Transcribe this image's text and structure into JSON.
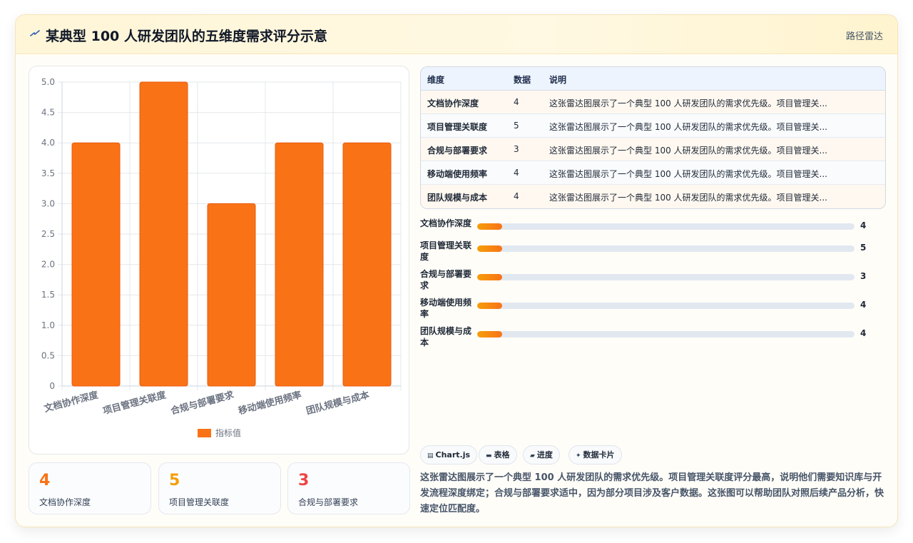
{
  "header": {
    "title": "某典型 100 人研发团队的五维度需求评分示意",
    "route_link": "路径雷达",
    "logo_icon": "lightning-icon"
  },
  "chart_data": {
    "type": "bar",
    "categories": [
      "文档协作深度",
      "项目管理关联度",
      "合规与部署要求",
      "移动端使用频率",
      "团队规模与成本"
    ],
    "series": [
      {
        "name": "指标值",
        "values": [
          4,
          5,
          3,
          4,
          4
        ],
        "color": "#f97316"
      }
    ],
    "ylim": [
      0,
      5
    ],
    "yticks": [
      "0",
      "0.5",
      "1.0",
      "1.5",
      "2.0",
      "2.5",
      "3.0",
      "3.5",
      "4.0",
      "4.5",
      "5.0"
    ],
    "grid": true,
    "legend": "bottom"
  },
  "stats": [
    {
      "value": "4",
      "label": "文档协作深度",
      "color": "#f97316"
    },
    {
      "value": "5",
      "label": "项目管理关联度",
      "color": "#f59e0b"
    },
    {
      "value": "3",
      "label": "合规与部署要求",
      "color": "#ef4444"
    }
  ],
  "table": {
    "headers": [
      "维度",
      "数据",
      "说明"
    ],
    "rows": [
      [
        "文档协作深度",
        "4",
        "这张雷达图展示了一个典型 100 人研发团队的需求优先级。项目管理关..."
      ],
      [
        "项目管理关联度",
        "5",
        "这张雷达图展示了一个典型 100 人研发团队的需求优先级。项目管理关..."
      ],
      [
        "合规与部署要求",
        "3",
        "这张雷达图展示了一个典型 100 人研发团队的需求优先级。项目管理关..."
      ],
      [
        "移动端使用频率",
        "4",
        "这张雷达图展示了一个典型 100 人研发团队的需求优先级。项目管理关..."
      ],
      [
        "团队规模与成本",
        "4",
        "这张雷达图展示了一个典型 100 人研发团队的需求优先级。项目管理关..."
      ]
    ]
  },
  "progress": [
    {
      "label": "文档协作深度",
      "value": "4",
      "fill_fraction": 0.066
    },
    {
      "label": "项目管理关联度",
      "value": "5",
      "fill_fraction": 0.066
    },
    {
      "label": "合规与部署要求",
      "value": "3",
      "fill_fraction": 0.066
    },
    {
      "label": "移动端使用频率",
      "value": "4",
      "fill_fraction": 0.066
    },
    {
      "label": "团队规模与成本",
      "value": "4",
      "fill_fraction": 0.066
    }
  ],
  "tags": [
    {
      "icon": "chart-icon",
      "label": "Chart.js"
    },
    {
      "icon": "table-icon",
      "label": "表格"
    },
    {
      "icon": "progress-icon",
      "label": "进度"
    },
    {
      "icon": "sparkle-icon",
      "label": "数据卡片"
    }
  ],
  "description": "这张雷达图展示了一个典型 100 人研发团队的需求优先级。项目管理关联度评分最高，说明他们需要知识库与开发流程深度绑定；合规与部署要求适中，因为部分项目涉及客户数据。这张图可以帮助团队对照后续产品分析，快速定位匹配度。"
}
